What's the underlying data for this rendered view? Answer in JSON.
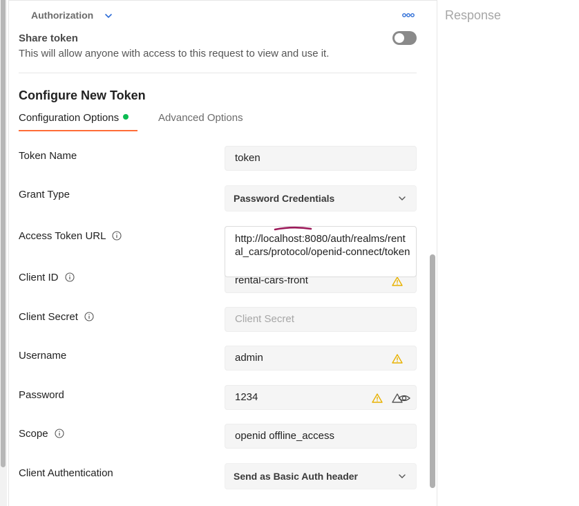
{
  "header": {
    "section_label": "Authorization",
    "more_icon": "more-icon"
  },
  "share": {
    "title": "Share token",
    "description": "This will allow anyone with access to this request to view and use it.",
    "enabled": false
  },
  "configure": {
    "title": "Configure New Token",
    "tabs": [
      {
        "label": "Configuration Options",
        "active": true,
        "indicator_color": "#0cbb52"
      },
      {
        "label": "Advanced Options",
        "active": false
      }
    ],
    "accent_color": "#ff6c37"
  },
  "fields": {
    "token_name": {
      "label": "Token Name",
      "value": "token"
    },
    "grant_type": {
      "label": "Grant Type",
      "value": "Password Credentials"
    },
    "access_token_url": {
      "label": "Access Token URL",
      "value": "http://localhost:8080/auth/realms/rental_cars/protocol/openid-connect/token"
    },
    "client_id": {
      "label": "Client ID",
      "value": "rental-cars-front"
    },
    "client_secret": {
      "label": "Client Secret",
      "value": "",
      "placeholder": "Client Secret"
    },
    "username": {
      "label": "Username",
      "value": "admin"
    },
    "password": {
      "label": "Password",
      "value": "1234"
    },
    "scope": {
      "label": "Scope",
      "value": "openid offline_access"
    },
    "client_authentication": {
      "label": "Client Authentication",
      "value": "Send as Basic Auth header"
    }
  },
  "response_panel": {
    "title": "Response"
  },
  "colors": {
    "warning": "#e8b100",
    "annotation": "#9c1a5a"
  }
}
